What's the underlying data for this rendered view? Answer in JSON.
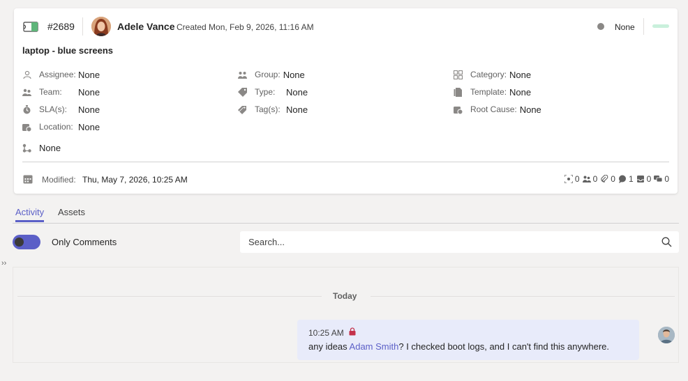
{
  "ticket": {
    "number": "#2689",
    "creator": "Adele Vance",
    "created": "Created Mon, Feb 9, 2026, 11:16 AM",
    "status": "None",
    "title": "laptop - blue screens"
  },
  "fields": {
    "assignee_label": "Assignee:",
    "assignee_value": "None",
    "team_label": "Team:",
    "team_value": "None",
    "sla_label": "SLA(s):",
    "sla_value": "None",
    "location_label": "Location:",
    "location_value": "None",
    "workflow_value": "None",
    "group_label": "Group:",
    "group_value": "None",
    "type_label": "Type:",
    "type_value": "None",
    "tags_label": "Tag(s):",
    "tags_value": "None",
    "category_label": "Category:",
    "category_value": "None",
    "template_label": "Template:",
    "template_value": "None",
    "rootcause_label": "Root Cause:",
    "rootcause_value": "None"
  },
  "footer": {
    "modified_label": "Modified:",
    "modified_value": "Thu, May 7, 2026, 10:25 AM",
    "counts": [
      "0",
      "0",
      "0",
      "1",
      "0",
      "0"
    ]
  },
  "tabs": [
    "Activity",
    "Assets"
  ],
  "filter": {
    "only_comments_label": "Only Comments",
    "only_comments_on": true
  },
  "search": {
    "placeholder": "Search..."
  },
  "feed": {
    "divider": "Today",
    "message": {
      "time": "10:25 AM",
      "text_before": "any ideas ",
      "mention": "Adam Smith",
      "text_after": "? I checked boot logs, and I can't find this anywhere."
    }
  },
  "colors": {
    "accent": "#5b5fc7",
    "bubble": "#e8ebfa",
    "status_dot": "#8a8886",
    "priority": "#c9f0dc",
    "lock": "#c4314b"
  },
  "icons": [
    "ticket-icon",
    "assignee-icon",
    "team-icon",
    "timer-icon",
    "location-icon",
    "workflow-icon",
    "group-icon",
    "tag-icon",
    "tags-icon",
    "category-icon",
    "template-icon",
    "root-cause-icon",
    "calendar-icon",
    "search-icon",
    "lock-icon"
  ]
}
